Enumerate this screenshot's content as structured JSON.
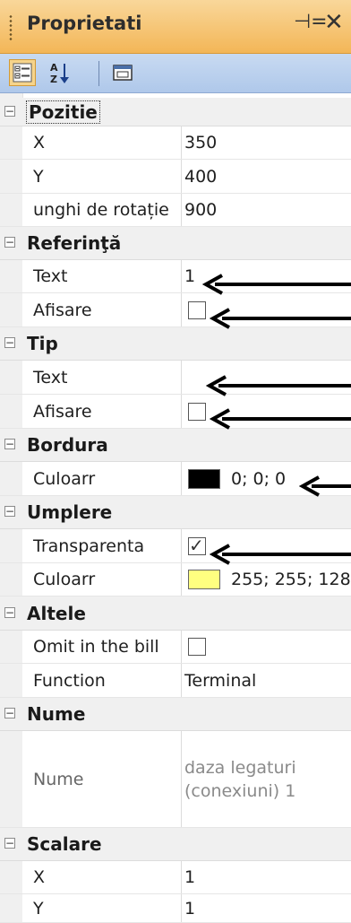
{
  "window": {
    "title": "Proprietati",
    "pin_glyph": "⊣=",
    "close_glyph": "✕"
  },
  "toolbar": {
    "buttons": [
      {
        "name": "categorized-view-button",
        "icon": "categorized-icon",
        "active": true
      },
      {
        "name": "alphabetical-sort-button",
        "icon": "sort-az-icon",
        "active": false
      },
      {
        "name": "property-pages-button",
        "icon": "property-pages-icon",
        "active": false
      }
    ]
  },
  "groups": {
    "pozitie": {
      "label": "Pozitie",
      "toggle": "−"
    },
    "referinta": {
      "label": "Referinţă",
      "toggle": "−"
    },
    "tip": {
      "label": "Tip",
      "toggle": "−"
    },
    "bordura": {
      "label": "Bordura",
      "toggle": "−"
    },
    "umplere": {
      "label": "Umplere",
      "toggle": "−"
    },
    "altele": {
      "label": "Altele",
      "toggle": "−"
    },
    "nume": {
      "label": "Nume",
      "toggle": "−"
    },
    "scalare": {
      "label": "Scalare",
      "toggle": "−"
    }
  },
  "props": {
    "pozitie_x": {
      "name": "X",
      "value": "350"
    },
    "pozitie_y": {
      "name": "Y",
      "value": "400"
    },
    "unghi": {
      "name": "unghi de rotație",
      "value": "900"
    },
    "ref_text": {
      "name": "Text",
      "value": "1"
    },
    "ref_afisare": {
      "name": "Afisare",
      "checked": false
    },
    "tip_text": {
      "name": "Text",
      "value": ""
    },
    "tip_afisare": {
      "name": "Afisare",
      "checked": false
    },
    "bordura_culoare": {
      "name": "Culoarr",
      "value": "0; 0; 0",
      "color": "#000000"
    },
    "transparenta": {
      "name": "Transparenta",
      "checked": true,
      "check_glyph": "✓"
    },
    "umplere_culoare": {
      "name": "Culoarr",
      "value": "255; 255; 128",
      "color": "#ffff80"
    },
    "omit": {
      "name": "Omit in the bill",
      "checked": false
    },
    "function": {
      "name": "Function",
      "value": "Terminal"
    },
    "nume": {
      "name": "Nume",
      "value": "daza legaturi (conexiuni) 1"
    },
    "scalare_x": {
      "name": "X",
      "value": "1"
    },
    "scalare_y": {
      "name": "Y",
      "value": "1"
    }
  },
  "annotations": {
    "arrow_color": "#000000",
    "arrows": 6
  }
}
